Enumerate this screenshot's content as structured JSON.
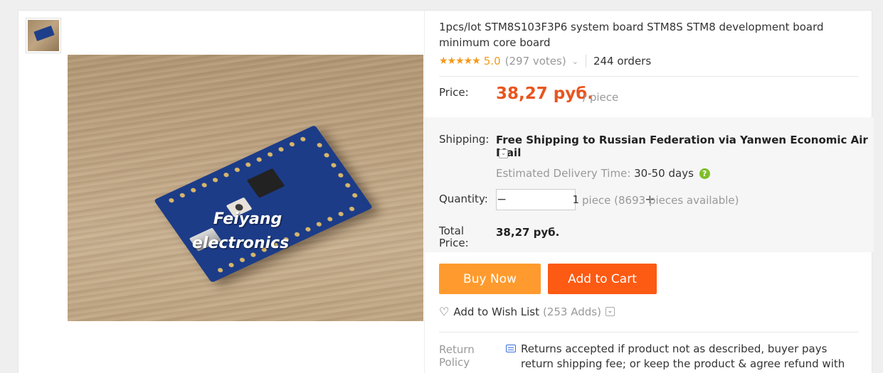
{
  "product": {
    "title": "1pcs/lot STM8S103F3P6 system board STM8S STM8 development board minimum core board",
    "image_watermark_line1": "Feiyang",
    "image_watermark_line2": "electronics"
  },
  "rating": {
    "stars": "★★★★★",
    "value": "5.0",
    "votes": "(297 votes)",
    "orders": "244 orders"
  },
  "price": {
    "label": "Price:",
    "value": "38,27 руб.",
    "unit": "/ piece"
  },
  "shipping": {
    "label": "Shipping:",
    "text_prefix": "Free Shipping to",
    "text_rest": "Russian Federation via Yanwen Economic Air Mail",
    "est_label": "Estimated Delivery Time:",
    "est_value": "30-50 days"
  },
  "quantity": {
    "label": "Quantity:",
    "value": "1",
    "minus": "−",
    "plus": "+",
    "available": "piece (8693 pieces available)"
  },
  "total": {
    "label_line1": "Total",
    "label_line2": "Price:",
    "value": "38,27 руб."
  },
  "actions": {
    "buy_now": "Buy Now",
    "add_to_cart": "Add to Cart",
    "wish_label": "Add to Wish List",
    "wish_adds": "(253 Adds)"
  },
  "return_policy": {
    "label_line1": "Return",
    "label_line2": "Policy",
    "text": "Returns accepted if product not as described, buyer pays return shipping fee; or keep the product & agree refund with seller."
  },
  "colors": {
    "accent_orange": "#e8551f",
    "buy_now_bg": "#ff9b2e",
    "add_to_cart_bg": "#fd5a13",
    "star_color": "#f39a1c",
    "help_icon_green": "#7dbf27"
  }
}
